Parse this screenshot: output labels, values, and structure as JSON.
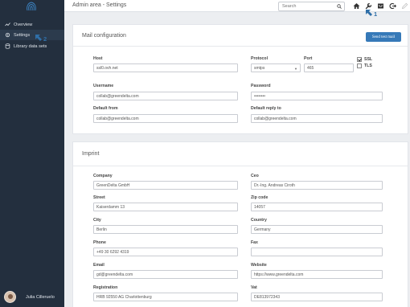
{
  "header": {
    "title": "Admin area - Settings",
    "search_placeholder": "Search"
  },
  "sidebar": {
    "items": [
      {
        "label": "Overview",
        "icon": "chart-icon"
      },
      {
        "label": "Settings",
        "icon": "gear-icon"
      },
      {
        "label": "Library data sets",
        "icon": "database-icon"
      }
    ],
    "user_name": "Julia Cilleruelo"
  },
  "annotations": [
    "1",
    "2"
  ],
  "mail": {
    "title": "Mail configuration",
    "test_button": "Send test mail",
    "host_label": "Host",
    "host": "ssl0.ovh.net",
    "protocol_label": "Protocol",
    "protocol": "smtps",
    "port_label": "Port",
    "port": "465",
    "ssl_label": "SSL",
    "ssl_checked": true,
    "tls_label": "TLS",
    "tls_checked": false,
    "username_label": "Username",
    "username": "collab@greendelta.com",
    "password_label": "Password",
    "password": "••••••••",
    "from_label": "Default from",
    "from": "collab@greendelta.com",
    "reply_label": "Default reply to",
    "reply": "collab@greendelta.com"
  },
  "imprint": {
    "title": "Imprint",
    "company_label": "Company",
    "company": "GreenDelta GmbH",
    "ceo_label": "Ceo",
    "ceo": "Dr.-Ing. Andreas Ciroth",
    "street_label": "Street",
    "street": "Kaiserdamm 13",
    "zip_label": "Zip code",
    "zip": "14057",
    "city_label": "City",
    "city": "Berlin",
    "country_label": "Country",
    "country": "Germany",
    "phone_label": "Phone",
    "phone": "+49 30 6292 4319",
    "fax_label": "Fax",
    "fax": "",
    "email_label": "Email",
    "email": "gd@greendelta.com",
    "website_label": "Website",
    "website": "https://www.greendelta.com",
    "registration_label": "Registration",
    "registration": "HRB 92550 AG Charlottenburg",
    "vat_label": "Vat",
    "vat": "DE813972343"
  },
  "colors": {
    "sidebar": "#232f3e",
    "accent": "#3679b8",
    "annotation": "#2f6fa8"
  }
}
